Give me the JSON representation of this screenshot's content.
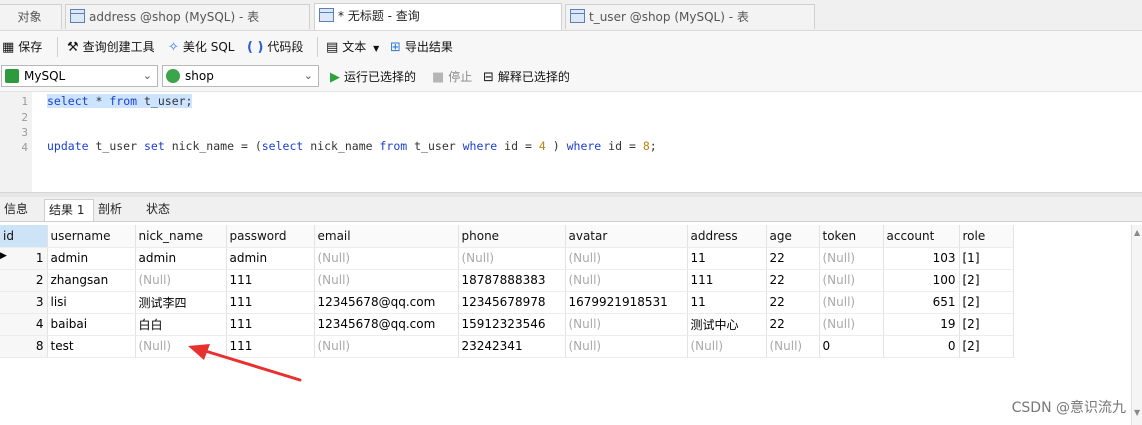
{
  "tabs": [
    {
      "label": "对象"
    },
    {
      "label": "address @shop (MySQL) - 表"
    },
    {
      "label": "* 无标题 - 查询"
    },
    {
      "label": "t_user @shop (MySQL) - 表"
    }
  ],
  "toolbar": {
    "save": "保存",
    "query_builder": "查询创建工具",
    "beautify": "美化 SQL",
    "snippet": "代码段",
    "text": "文本",
    "export": "导出结果"
  },
  "connection": {
    "server": "MySQL",
    "database": "shop",
    "run_selected": "运行已选择的",
    "stop": "停止",
    "explain_selected": "解释已选择的"
  },
  "editor": {
    "line_numbers": [
      "1",
      "2",
      "3",
      "4"
    ],
    "line1": "select * from t_user;",
    "line4": "update t_user set nick_name = (select nick_name from t_user where id = 4 ) where id = 8;"
  },
  "result_tabs": [
    "信息",
    "结果 1",
    "剖析",
    "状态"
  ],
  "columns": [
    "id",
    "username",
    "nick_name",
    "password",
    "email",
    "phone",
    "avatar",
    "address",
    "age",
    "token",
    "account",
    "role"
  ],
  "rows": [
    [
      "1",
      "admin",
      "admin",
      "admin",
      "(Null)",
      "(Null)",
      "(Null)",
      "11",
      "22",
      "(Null)",
      "103",
      "[1]"
    ],
    [
      "2",
      "zhangsan",
      "(Null)",
      "111",
      "(Null)",
      "18787888383",
      "(Null)",
      "111",
      "22",
      "(Null)",
      "100",
      "[2]"
    ],
    [
      "3",
      "lisi",
      "测试李四",
      "111",
      "12345678@qq.com",
      "12345678978",
      "1679921918531",
      "11",
      "22",
      "(Null)",
      "651",
      "[2]"
    ],
    [
      "4",
      "baibai",
      "白白",
      "111",
      "12345678@qq.com",
      "15912323546",
      "(Null)",
      "测试中心",
      "22",
      "(Null)",
      "19",
      "[2]"
    ],
    [
      "8",
      "test",
      "(Null)",
      "111",
      "(Null)",
      "23242341",
      "(Null)",
      "(Null)",
      "(Null)",
      "0",
      "0",
      "[2]"
    ]
  ],
  "watermark": "CSDN @意识流九",
  "colors": {
    "arrow": "#e8312f",
    "keyword": "#1b3fd0",
    "number": "#b8860b",
    "null": "#a9a9a9"
  }
}
